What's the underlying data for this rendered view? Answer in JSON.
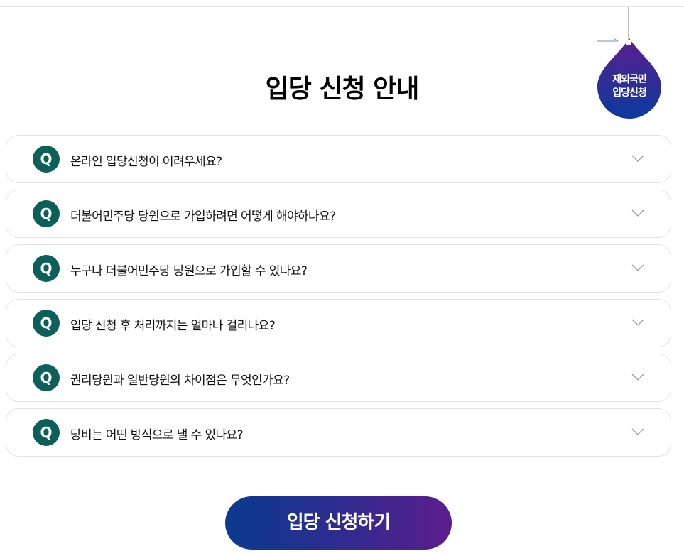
{
  "page": {
    "title": "입당 신청 안내"
  },
  "overseas_badge": {
    "line1": "재외국민",
    "line2": "입당신청",
    "icon": "arrow-right-icon",
    "colors": [
      "#5a1e8c",
      "#0b3a9e"
    ]
  },
  "faq": {
    "q_label": "Q",
    "items": [
      {
        "question": "온라인 입당신청이 어려우세요?"
      },
      {
        "question": "더불어민주당 당원으로 가입하려면 어떻게 해야하나요?"
      },
      {
        "question": "누구나 더불어민주당 당원으로 가입할 수 있나요?"
      },
      {
        "question": "입당 신청 후 처리까지는 얼마나 걸리나요?"
      },
      {
        "question": "권리당원과 일반당원의 차이점은 무엇인가요?"
      },
      {
        "question": "당비는 어떤 방식으로 낼 수 있나요?"
      }
    ],
    "expand_icon": "chevron-down-icon",
    "badge_color": "#0d5f5a"
  },
  "apply": {
    "label": "입당 신청하기",
    "colors": [
      "#0b3a8e",
      "#5b1d8c"
    ]
  }
}
